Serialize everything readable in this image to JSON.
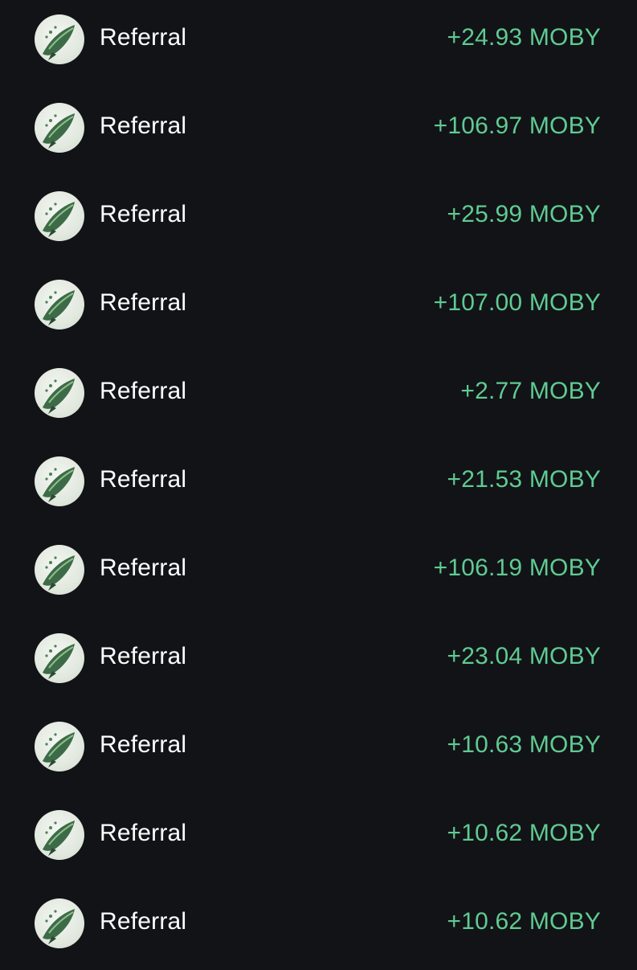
{
  "transactions": [
    {
      "label": "Referral",
      "amount": "+24.93 MOBY",
      "icon": "whale-token-icon"
    },
    {
      "label": "Referral",
      "amount": "+106.97 MOBY",
      "icon": "whale-token-icon"
    },
    {
      "label": "Referral",
      "amount": "+25.99 MOBY",
      "icon": "whale-token-icon"
    },
    {
      "label": "Referral",
      "amount": "+107.00 MOBY",
      "icon": "whale-token-icon"
    },
    {
      "label": "Referral",
      "amount": "+2.77 MOBY",
      "icon": "whale-token-icon"
    },
    {
      "label": "Referral",
      "amount": "+21.53 MOBY",
      "icon": "whale-token-icon"
    },
    {
      "label": "Referral",
      "amount": "+106.19 MOBY",
      "icon": "whale-token-icon"
    },
    {
      "label": "Referral",
      "amount": "+23.04 MOBY",
      "icon": "whale-token-icon"
    },
    {
      "label": "Referral",
      "amount": "+10.63 MOBY",
      "icon": "whale-token-icon"
    },
    {
      "label": "Referral",
      "amount": "+10.62 MOBY",
      "icon": "whale-token-icon"
    },
    {
      "label": "Referral",
      "amount": "+10.62 MOBY",
      "icon": "whale-token-icon"
    }
  ],
  "colors": {
    "background": "#121317",
    "label_text": "#ffffff",
    "amount_positive": "#5fcb92"
  }
}
